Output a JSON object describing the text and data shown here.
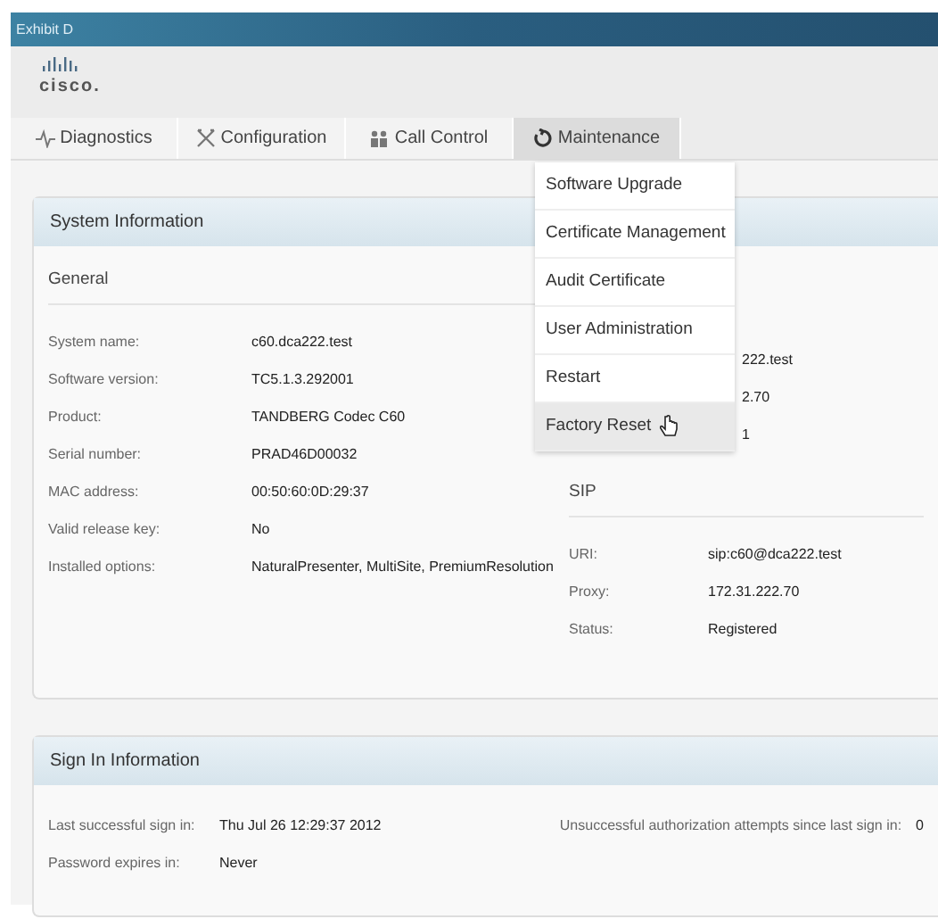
{
  "window": {
    "title": "Exhibit D"
  },
  "logo": {
    "text": "cisco."
  },
  "tabs": [
    {
      "label": "Diagnostics",
      "selected": false
    },
    {
      "label": "Configuration",
      "selected": false
    },
    {
      "label": "Call Control",
      "selected": false
    },
    {
      "label": "Maintenance",
      "selected": true
    }
  ],
  "menu": {
    "items": [
      {
        "label": "Software Upgrade",
        "hovered": false
      },
      {
        "label": "Certificate Management",
        "hovered": false
      },
      {
        "label": "Audit Certificate",
        "hovered": false
      },
      {
        "label": "User Administration",
        "hovered": false
      },
      {
        "label": "Restart",
        "hovered": false
      },
      {
        "label": "Factory Reset",
        "hovered": true
      }
    ]
  },
  "system_information": {
    "title": "System Information",
    "general": {
      "heading": "General",
      "rows": [
        {
          "label": "System name:",
          "value": "c60.dca222.test"
        },
        {
          "label": "Software version:",
          "value": "TC5.1.3.292001"
        },
        {
          "label": "Product:",
          "value": "TANDBERG Codec C60"
        },
        {
          "label": "Serial number:",
          "value": "PRAD46D00032"
        },
        {
          "label": "MAC address:",
          "value": "00:50:60:0D:29:37"
        },
        {
          "label": "Valid release key:",
          "value": "No"
        },
        {
          "label": "Installed options:",
          "value": "NaturalPresenter, MultiSite, PremiumResolution"
        }
      ]
    },
    "partial_values": [
      "222.test",
      "2.70",
      "1"
    ],
    "sip": {
      "heading": "SIP",
      "rows": [
        {
          "label": "URI:",
          "value": "sip:c60@dca222.test"
        },
        {
          "label": "Proxy:",
          "value": "172.31.222.70"
        },
        {
          "label": "Status:",
          "value": "Registered"
        }
      ]
    }
  },
  "sign_in_information": {
    "title": "Sign In Information",
    "rows": [
      {
        "label": "Last successful sign in:",
        "value": "Thu Jul 26 12:29:37 2012"
      },
      {
        "label": "Password expires in:",
        "value": "Never"
      }
    ],
    "attempts": {
      "label": "Unsuccessful authorization attempts since last sign in:",
      "value": "0"
    }
  }
}
